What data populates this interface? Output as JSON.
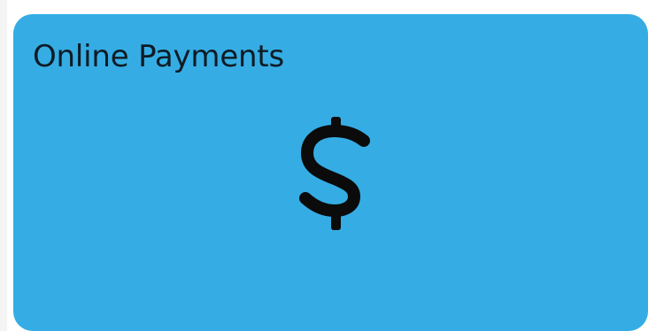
{
  "tile": {
    "title": "Online Payments",
    "icon": "dollar-sign-icon",
    "background_color": "#35ade4",
    "text_color": "#0f1b24"
  }
}
